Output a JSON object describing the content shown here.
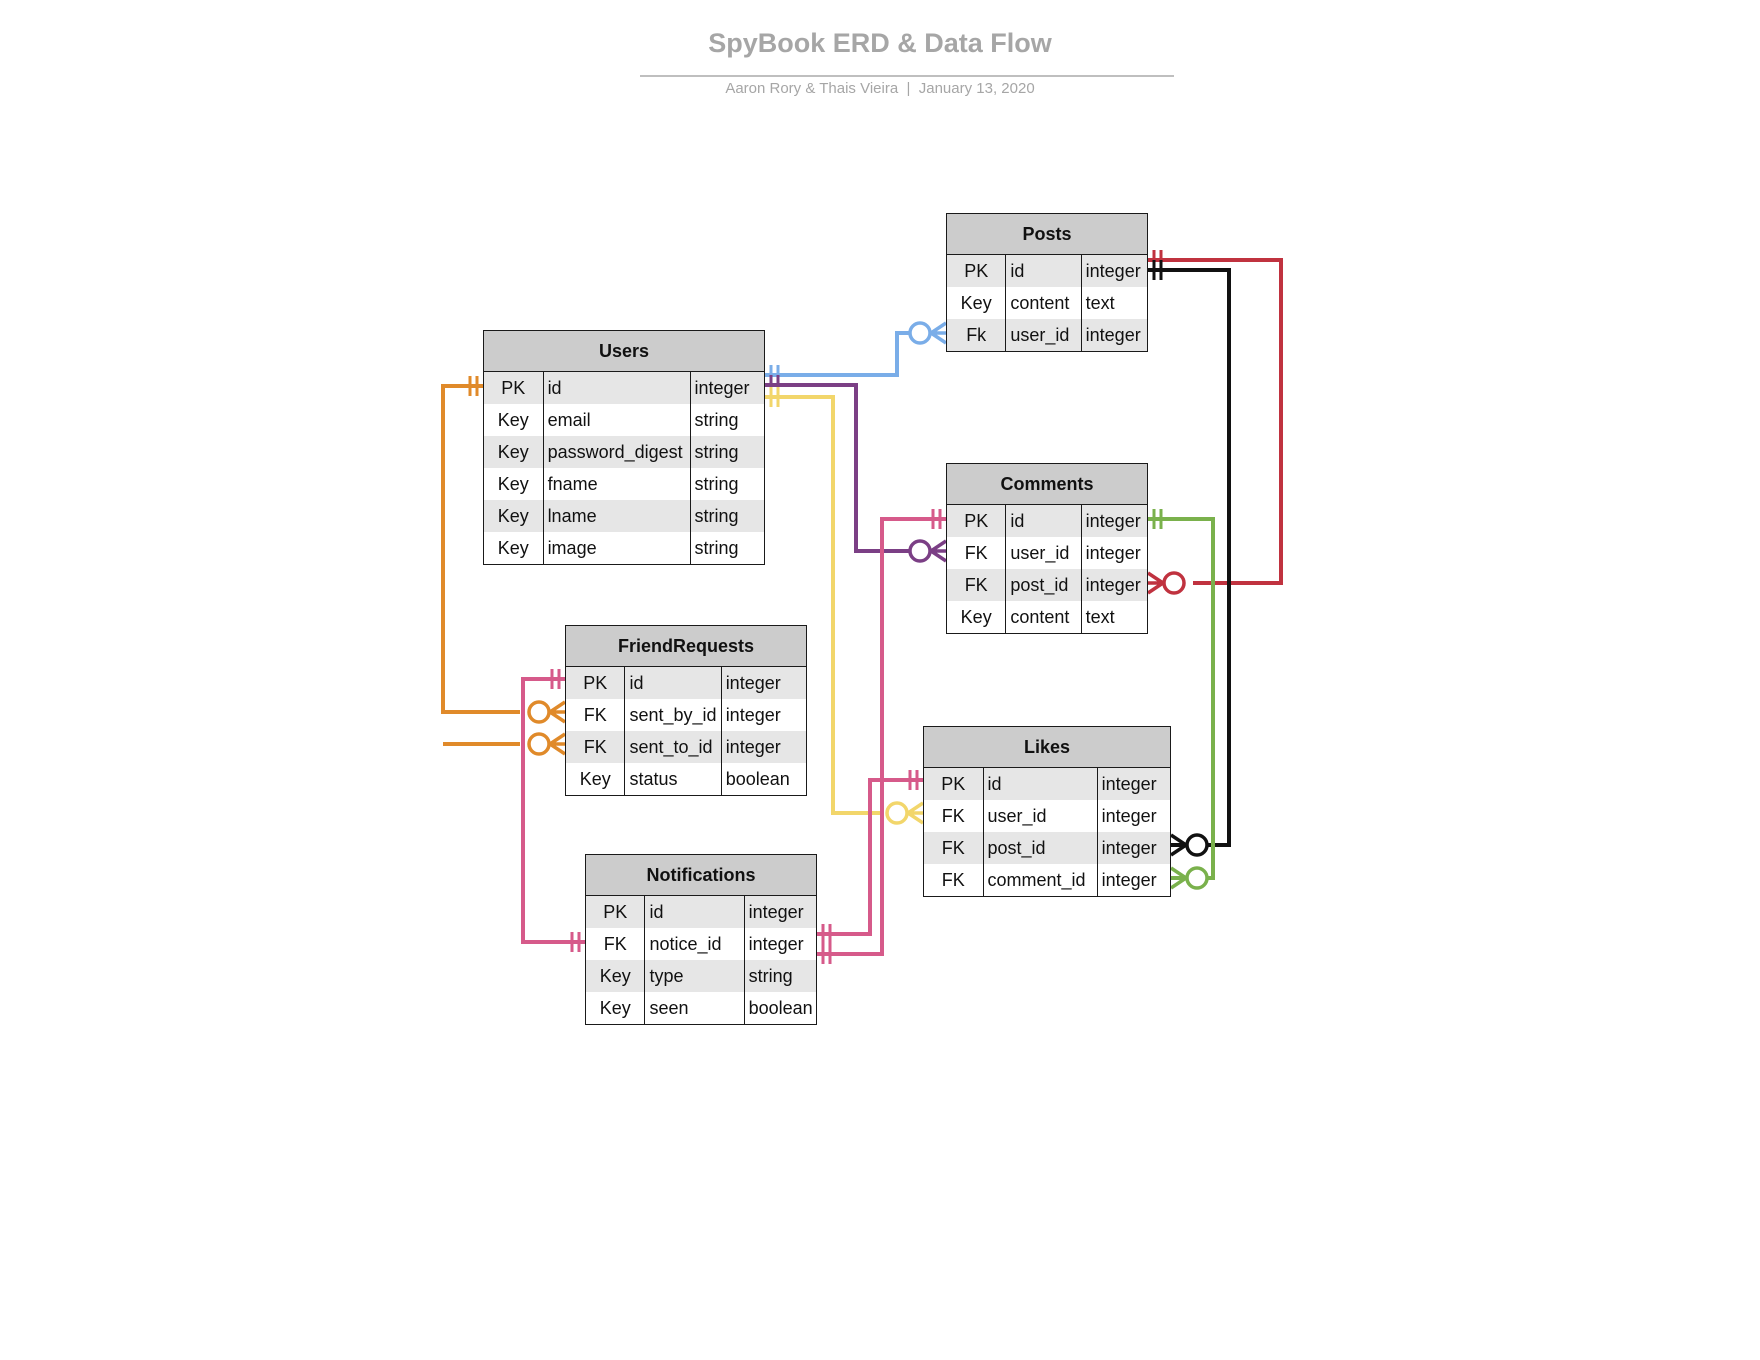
{
  "title": "SpyBook ERD & Data Flow",
  "subtitle": "Aaron Rory & Thais Vieira  |  January 13, 2020",
  "entities": {
    "posts": {
      "name": "Posts",
      "rows": [
        {
          "key": "PK",
          "field": "id",
          "type": "integer"
        },
        {
          "key": "Key",
          "field": "content",
          "type": "text"
        },
        {
          "key": "Fk",
          "field": "user_id",
          "type": "integer"
        }
      ]
    },
    "users": {
      "name": "Users",
      "rows": [
        {
          "key": "PK",
          "field": "id",
          "type": "integer"
        },
        {
          "key": "Key",
          "field": "email",
          "type": "string"
        },
        {
          "key": "Key",
          "field": "password_digest",
          "type": "string"
        },
        {
          "key": "Key",
          "field": "fname",
          "type": "string"
        },
        {
          "key": "Key",
          "field": "lname",
          "type": "string"
        },
        {
          "key": "Key",
          "field": "image",
          "type": "string"
        }
      ]
    },
    "comments": {
      "name": "Comments",
      "rows": [
        {
          "key": "PK",
          "field": "id",
          "type": "integer"
        },
        {
          "key": "FK",
          "field": "user_id",
          "type": "integer"
        },
        {
          "key": "FK",
          "field": "post_id",
          "type": "integer"
        },
        {
          "key": "Key",
          "field": "content",
          "type": "text"
        }
      ]
    },
    "friend_requests": {
      "name": "FriendRequests",
      "rows": [
        {
          "key": "PK",
          "field": "id",
          "type": "integer"
        },
        {
          "key": "FK",
          "field": "sent_by_id",
          "type": "integer"
        },
        {
          "key": "FK",
          "field": "sent_to_id",
          "type": "integer"
        },
        {
          "key": "Key",
          "field": "status",
          "type": "boolean"
        }
      ]
    },
    "likes": {
      "name": "Likes",
      "rows": [
        {
          "key": "PK",
          "field": "id",
          "type": "integer"
        },
        {
          "key": "FK",
          "field": "user_id",
          "type": "integer"
        },
        {
          "key": "FK",
          "field": "post_id",
          "type": "integer"
        },
        {
          "key": "FK",
          "field": "comment_id",
          "type": "integer"
        }
      ]
    },
    "notifications": {
      "name": "Notifications",
      "rows": [
        {
          "key": "PK",
          "field": "id",
          "type": "integer"
        },
        {
          "key": "FK",
          "field": "notice_id",
          "type": "integer"
        },
        {
          "key": "Key",
          "field": "type",
          "type": "string"
        },
        {
          "key": "Key",
          "field": "seen",
          "type": "boolean"
        }
      ]
    }
  },
  "relationship_colors": {
    "users_posts": "#7aade8",
    "users_comments": "#7b3f85",
    "users_likes": "#f2d66b",
    "users_friend_requests": "#e08a2a",
    "posts_comments": "#c0323f",
    "posts_likes": "#111111",
    "comments_likes": "#7ab14c",
    "notifications": "#d65a8a"
  }
}
